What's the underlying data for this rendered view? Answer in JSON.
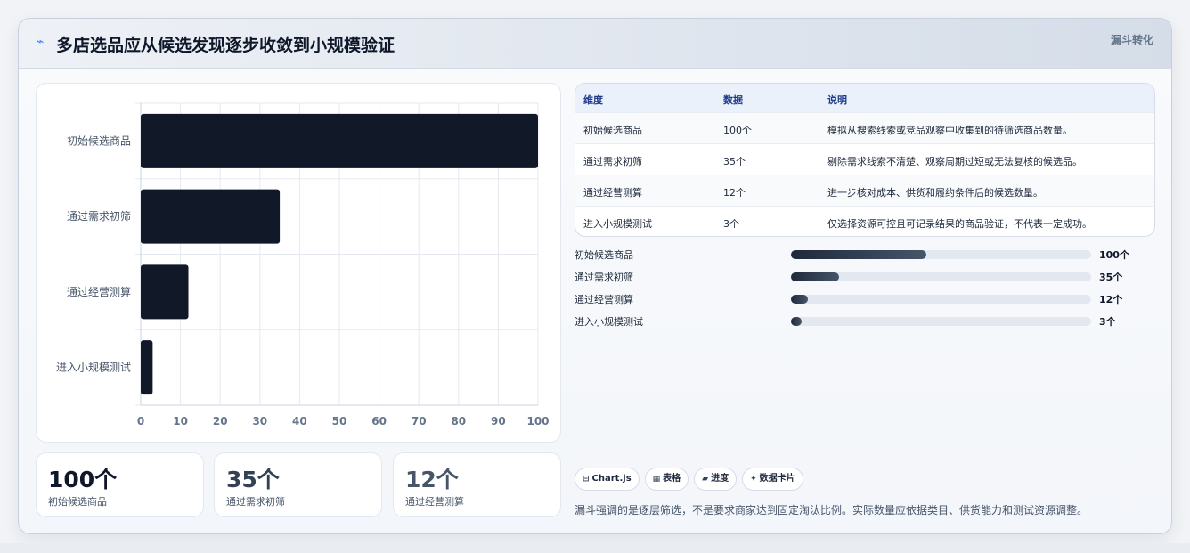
{
  "header": {
    "icon": "trend-line-icon",
    "title": "多店选品应从候选发现逐步收敛到小规模验证",
    "tag": "漏斗转化"
  },
  "chart_data": {
    "type": "bar",
    "orientation": "horizontal",
    "categories": [
      "初始候选商品",
      "通过需求初筛",
      "通过经营测算",
      "进入小规模测试"
    ],
    "values": [
      100,
      35,
      12,
      3
    ],
    "xlim": [
      0,
      100
    ],
    "xticks": [
      "0",
      "10",
      "20",
      "30",
      "40",
      "50",
      "60",
      "70",
      "80",
      "90",
      "100"
    ],
    "grid": true,
    "bar_color": "#111827",
    "title": "",
    "xlabel": "",
    "ylabel": ""
  },
  "kpis": [
    {
      "value": "100个",
      "label": "初始候选商品",
      "color": "#0f172a"
    },
    {
      "value": "35个",
      "label": "通过需求初筛",
      "color": "#334155"
    },
    {
      "value": "12个",
      "label": "通过经营测算",
      "color": "#475569"
    }
  ],
  "table": {
    "headers": [
      "维度",
      "数据",
      "说明"
    ],
    "rows": [
      [
        "初始候选商品",
        "100个",
        "模拟从搜索线索或竞品观察中收集到的待筛选商品数量。"
      ],
      [
        "通过需求初筛",
        "35个",
        "剔除需求线索不清楚、观察周期过短或无法复核的候选品。"
      ],
      [
        "通过经营测算",
        "12个",
        "进一步核对成本、供货和履约条件后的候选数量。"
      ],
      [
        "进入小规模测试",
        "3个",
        "仅选择资源可控且可记录结果的商品验证，不代表一定成功。"
      ]
    ]
  },
  "progress": [
    {
      "label": "初始候选商品",
      "value": "100个",
      "fraction": 0.45
    },
    {
      "label": "通过需求初筛",
      "value": "35个",
      "fraction": 0.16
    },
    {
      "label": "通过经营测算",
      "value": "12个",
      "fraction": 0.055
    },
    {
      "label": "进入小规模测试",
      "value": "3个",
      "fraction": 0.035
    }
  ],
  "chips": [
    {
      "icon": "⊟",
      "label": "Chart.js"
    },
    {
      "icon": "▦",
      "label": "表格"
    },
    {
      "icon": "▰",
      "label": "进度"
    },
    {
      "icon": "✦",
      "label": "数据卡片"
    }
  ],
  "note": "漏斗强调的是逐层筛选，不是要求商家达到固定淘汰比例。实际数量应依据类目、供货能力和测试资源调整。"
}
